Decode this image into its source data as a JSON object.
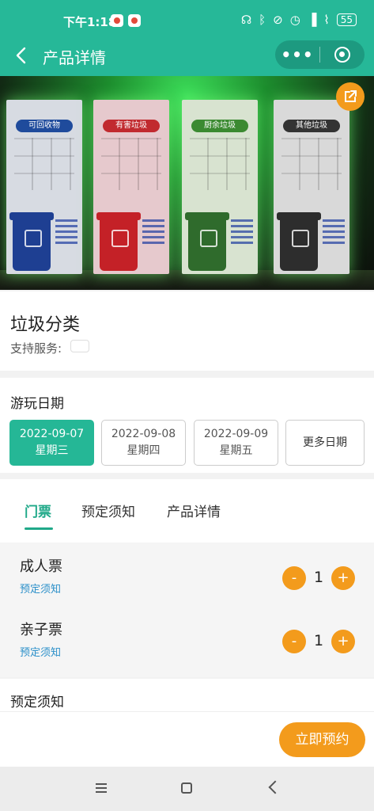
{
  "status_bar": {
    "time": "下午1:18",
    "battery": "55"
  },
  "navbar": {
    "title": "产品详情",
    "more_label": "•••"
  },
  "banner": {
    "panels": [
      {
        "title": "可回收物",
        "color": "#1f4b9c"
      },
      {
        "title": "有害垃圾",
        "color": "#c12a2f"
      },
      {
        "title": "厨余垃圾",
        "color": "#3b8a31"
      },
      {
        "title": "其他垃圾",
        "color": "#333333"
      }
    ]
  },
  "product": {
    "name": "垃圾分类",
    "service_label": "支持服务:"
  },
  "dates": {
    "title": "游玩日期",
    "items": [
      {
        "date": "2022-09-07",
        "weekday": "星期三",
        "selected": true
      },
      {
        "date": "2022-09-08",
        "weekday": "星期四",
        "selected": false
      },
      {
        "date": "2022-09-09",
        "weekday": "星期五",
        "selected": false
      }
    ],
    "more_label": "更多日期"
  },
  "tabs": [
    {
      "label": "门票",
      "active": true
    },
    {
      "label": "预定须知",
      "active": false
    },
    {
      "label": "产品详情",
      "active": false
    }
  ],
  "tickets": [
    {
      "name": "成人票",
      "note": "预定须知",
      "quantity": "1",
      "minus": "-",
      "plus": "+"
    },
    {
      "name": "亲子票",
      "note": "预定须知",
      "quantity": "1",
      "minus": "-",
      "plus": "+"
    }
  ],
  "notice": {
    "title": "预定须知"
  },
  "footer": {
    "book_label": "立即预约"
  },
  "colors": {
    "primary": "#26b898",
    "accent": "#f39b1c",
    "link": "#2a8fc9"
  }
}
